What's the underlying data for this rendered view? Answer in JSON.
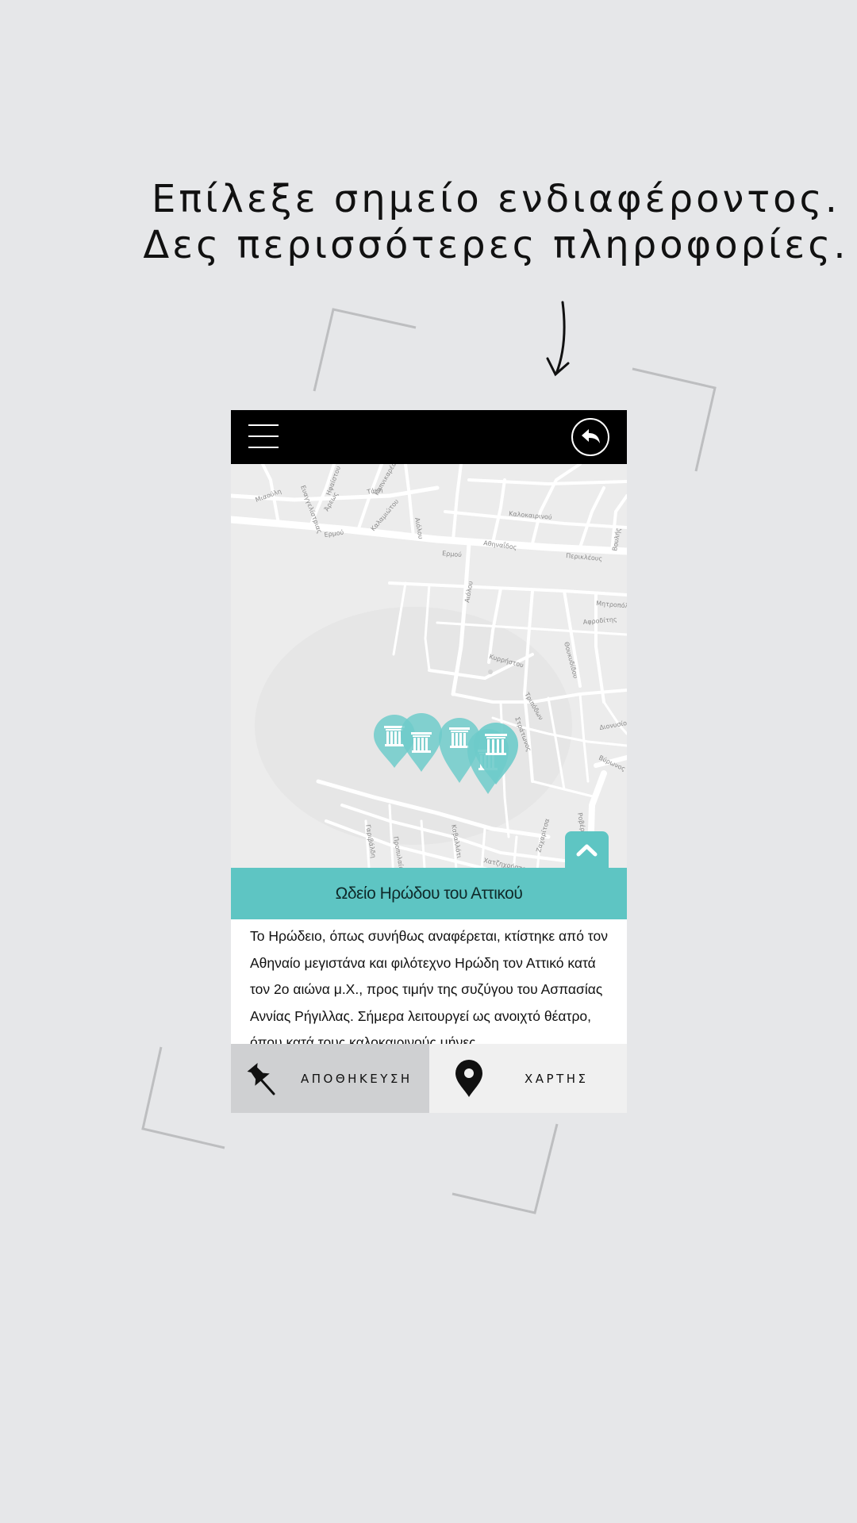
{
  "headline": {
    "line1": "Επίλεξε σημείο ενδιαφέροντος.",
    "line2": "Δες περισσότερες πληροφορίες."
  },
  "app": {
    "topbar": {
      "menu_icon": "hamburger-menu-icon",
      "back_icon": "back-arrow-icon"
    },
    "map": {
      "street_labels": [
        "Μιαούλη",
        "Ευαγγελίστριας",
        "Άρεως",
        "Ηφαίστου",
        "Ερμού",
        "Καλαμιώτου",
        "Αιόλου",
        "Τάκη",
        "Καπνικαρέα",
        "Καλοκαιρινού",
        "Αθηναΐδος",
        "Περικλέους",
        "Ερμού",
        "Βουλής",
        "Αιόλου",
        "Μητροπόλεως",
        "Αφροδίτης",
        "Κυρρήστου",
        "Θουκυδίδου",
        "Τριπόδων",
        "Στράτωνος",
        "Βύρωνος",
        "Διονυσίου",
        "Γαριβάλδη",
        "Προπυλαίων",
        "Καβαλλότι",
        "Χατζηχρήστου",
        "Ζαχαρίτσα",
        "Ροβέρτου Γκάλλι"
      ],
      "marker_icon": "ancient-column-pin-icon",
      "marker_count": 5,
      "accent_color": "#5ec5c3"
    },
    "expand_icon": "chevron-up-icon",
    "place": {
      "title": "Ωδείο Ηρώδου του Αττικού",
      "description": "Το Ηρώδειο, όπως συνήθως αναφέρεται, κτίστηκε  από τον Αθηναίο μεγιστάνα και φιλότεχνο Ηρώδη τον Αττικό κατά τον 2ο αιώνα μ.Χ., προς τιμήν της συζύγου του Ασπασίας Αννίας Ρήγιλλας. Σήμερα λειτουργεί ως ανοιχτό θέατρο, όπου κατά τους καλοκαιρινούς μήνες"
    },
    "bottom_bar": {
      "save_label": "ΑΠΟΘΗΚΕΥΣΗ",
      "save_icon": "pushpin-icon",
      "map_label": "ΧΑΡΤΗΣ",
      "map_icon": "map-pin-icon"
    }
  }
}
